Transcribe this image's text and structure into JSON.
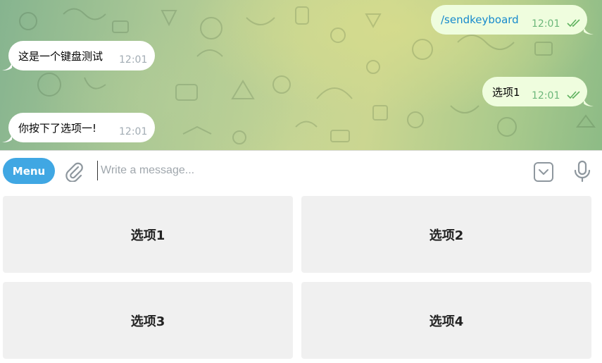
{
  "messages": {
    "sent_command": {
      "text": "/sendkeyboard",
      "time": "12:01"
    },
    "bot_keyboard_test": {
      "text": "这是一个键盘测试",
      "time": "12:01"
    },
    "sent_option": {
      "text": "选项1",
      "time": "12:01"
    },
    "bot_reply": {
      "text": "你按下了选项一!",
      "time": "12:01"
    }
  },
  "composer": {
    "menu_label": "Menu",
    "placeholder": "Write a message..."
  },
  "keyboard": {
    "buttons": [
      "选项1",
      "选项2",
      "选项3",
      "选项4"
    ]
  },
  "colors": {
    "accent": "#40a7e3",
    "outgoing_bubble": "#effdde",
    "incoming_bubble": "#ffffff",
    "command_link": "#168acd",
    "read_checks": "#5fb25f",
    "keyboard_button": "#f0f0f0"
  },
  "icons": {
    "attach": "paperclip-icon",
    "keyboard_toggle": "keyboard-toggle-icon",
    "voice": "microphone-icon",
    "read_status": "double-check-icon"
  }
}
